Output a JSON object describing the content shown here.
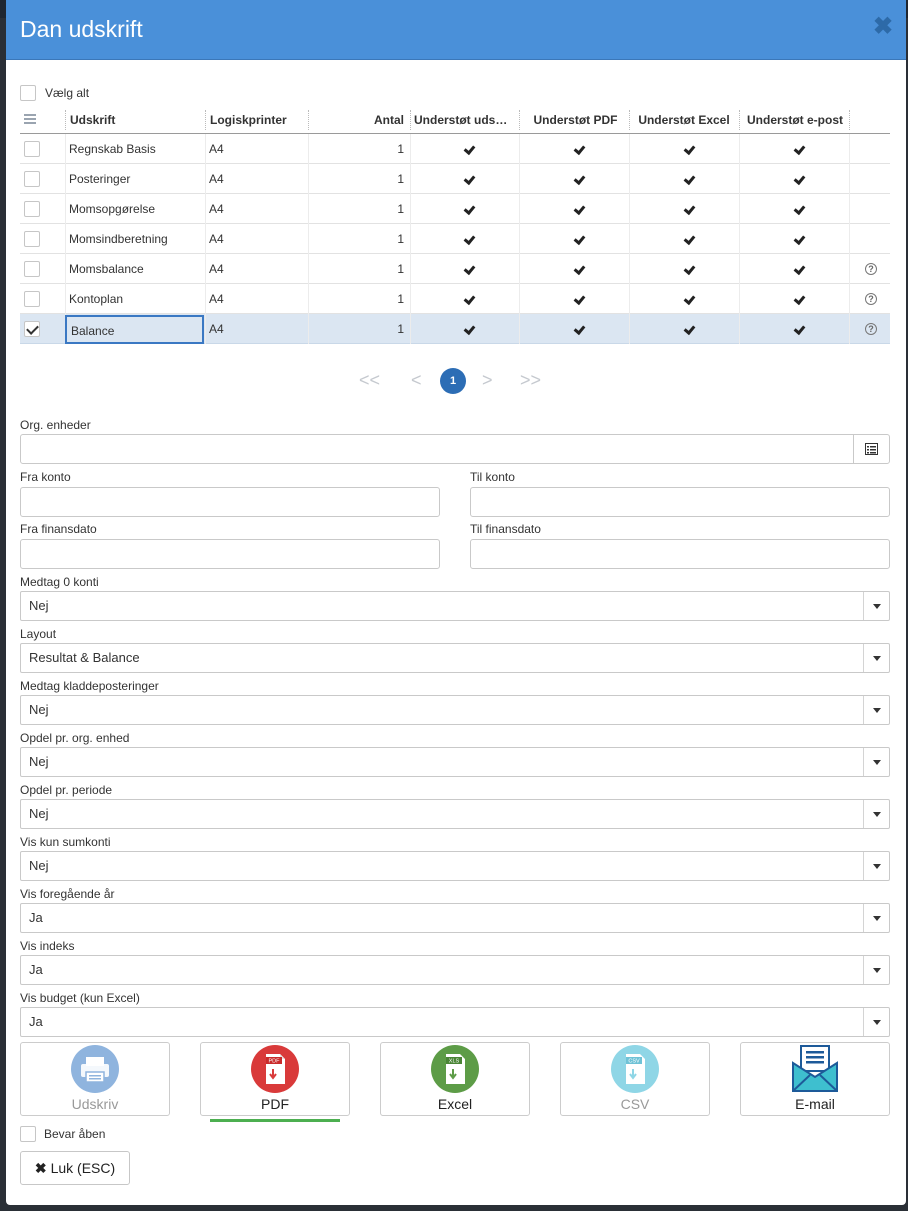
{
  "dialog": {
    "title": "Dan udskrift",
    "close_symbol": "✖"
  },
  "select_all_label": "Vælg alt",
  "grid": {
    "columns": [
      "Udskrift",
      "Logiskprinter",
      "Antal",
      "Understøt uds…",
      "Understøt PDF",
      "Understøt Excel",
      "Understøt e-post"
    ],
    "rows": [
      {
        "name": "Regnskab Basis",
        "printer": "A4",
        "count": "1",
        "print": true,
        "pdf": true,
        "excel": true,
        "email": true,
        "help": false,
        "checked": false
      },
      {
        "name": "Posteringer",
        "printer": "A4",
        "count": "1",
        "print": true,
        "pdf": true,
        "excel": true,
        "email": true,
        "help": false,
        "checked": false
      },
      {
        "name": "Momsopgørelse",
        "printer": "A4",
        "count": "1",
        "print": true,
        "pdf": true,
        "excel": true,
        "email": true,
        "help": false,
        "checked": false
      },
      {
        "name": "Momsindberetning",
        "printer": "A4",
        "count": "1",
        "print": true,
        "pdf": true,
        "excel": true,
        "email": true,
        "help": false,
        "checked": false
      },
      {
        "name": "Momsbalance",
        "printer": "A4",
        "count": "1",
        "print": true,
        "pdf": true,
        "excel": true,
        "email": true,
        "help": true,
        "checked": false
      },
      {
        "name": "Kontoplan",
        "printer": "A4",
        "count": "1",
        "print": true,
        "pdf": true,
        "excel": true,
        "email": true,
        "help": true,
        "checked": false
      },
      {
        "name": "Balance",
        "printer": "A4",
        "count": "1",
        "print": true,
        "pdf": true,
        "excel": true,
        "email": true,
        "help": true,
        "checked": true
      }
    ]
  },
  "pager": {
    "first": "<<",
    "prev": "<",
    "current": "1",
    "next": ">",
    "last": ">>"
  },
  "filters": {
    "org_label": "Org. enheder",
    "org_value": "",
    "fra_konto_label": "Fra konto",
    "til_konto_label": "Til konto",
    "fra_finans_label": "Fra finansdato",
    "til_finans_label": "Til finansdato"
  },
  "selects": [
    {
      "label": "Medtag 0 konti",
      "value": "Nej"
    },
    {
      "label": "Layout",
      "value": "Resultat & Balance"
    },
    {
      "label": "Medtag kladdeposteringer",
      "value": "Nej"
    },
    {
      "label": "Opdel pr. org. enhed",
      "value": "Nej"
    },
    {
      "label": "Opdel pr. periode",
      "value": "Nej"
    },
    {
      "label": "Vis kun sumkonti",
      "value": "Nej"
    },
    {
      "label": "Vis foregående år",
      "value": "Ja"
    },
    {
      "label": "Vis indeks",
      "value": "Ja"
    },
    {
      "label": "Vis budget (kun Excel)",
      "value": "Ja"
    }
  ],
  "actions": [
    {
      "label": "Udskriv",
      "icon": "printer-icon",
      "color": "#8fb4de",
      "enabled": false
    },
    {
      "label": "PDF",
      "icon": "pdf-icon",
      "color": "#d93a3a",
      "badge": "PDF",
      "enabled": true
    },
    {
      "label": "Excel",
      "icon": "excel-icon",
      "color": "#5d9c47",
      "badge": "XLS",
      "enabled": true
    },
    {
      "label": "CSV",
      "icon": "csv-icon",
      "color": "#8fd6e6",
      "badge": "CSV",
      "enabled": false
    },
    {
      "label": "E-mail",
      "icon": "email-icon",
      "color": "#3ebfcf",
      "enabled": true
    }
  ],
  "keep_open_label": "Bevar åben",
  "close_button": {
    "symbol": "✖",
    "label": "Luk (ESC)"
  }
}
